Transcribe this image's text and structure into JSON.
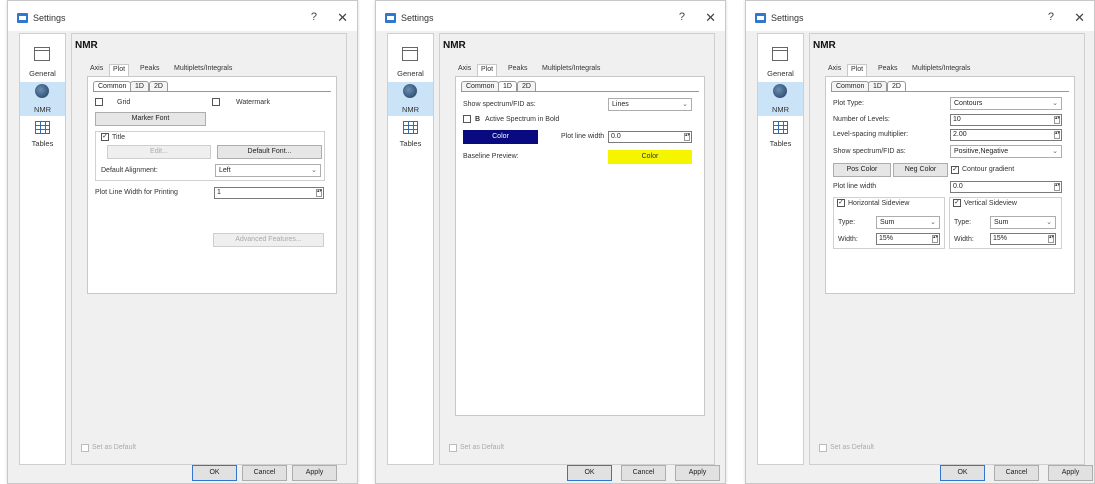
{
  "window": {
    "title": "Settings",
    "help": "?",
    "close": "✕"
  },
  "sidebar": {
    "general": "General",
    "nmr": "NMR",
    "tables": "Tables"
  },
  "page_title": "NMR",
  "tabs": {
    "axis": "Axis",
    "plot": "Plot",
    "peaks": "Peaks",
    "multiplets": "Multiplets/Integrals"
  },
  "subtabs": {
    "common": "Common",
    "d1": "1D",
    "d2": "2D"
  },
  "footer": {
    "set_default": "Set as Default",
    "ok": "OK",
    "cancel": "Cancel",
    "apply": "Apply"
  },
  "common": {
    "grid": "Grid",
    "watermark": "Watermark",
    "marker_font": "Marker Font",
    "title": "Title",
    "edit": "Edit...",
    "default_font": "Default Font...",
    "default_alignment_label": "Default Alignment:",
    "default_alignment_value": "Left",
    "plot_line_width_printing_label": "Plot Line Width for Printing",
    "plot_line_width_printing_value": "1",
    "advanced_features": "Advanced Features..."
  },
  "oned": {
    "show_spectrum_label": "Show spectrum/FID as:",
    "show_spectrum_value": "Lines",
    "active_bold": "Active Spectrum in Bold",
    "color_btn": "Color",
    "plot_line_width_label": "Plot line width",
    "plot_line_width_value": "0.0",
    "baseline_preview": "Baseline Preview:",
    "baseline_color": "Color",
    "color_blue": "#0a0a80",
    "color_yellow": "#f5f500"
  },
  "twod": {
    "plot_type_label": "Plot Type:",
    "plot_type_value": "Contours",
    "levels_label": "Number of Levels:",
    "levels_value": "10",
    "spacing_label": "Level-spacing multiplier:",
    "spacing_value": "2.00",
    "show_spectrum_label": "Show spectrum/FID as:",
    "show_spectrum_value": "Positive,Negative",
    "pos_color": "Pos Color",
    "neg_color": "Neg Color",
    "contour_gradient": "Contour gradient",
    "plot_line_width_label": "Plot line width",
    "plot_line_width_value": "0.0",
    "horizontal_sideview": "Horizontal Sideview",
    "vertical_sideview": "Vertical Sideview",
    "type_label": "Type:",
    "type_value": "Sum",
    "width_label": "Width:",
    "width_value": "15%"
  }
}
